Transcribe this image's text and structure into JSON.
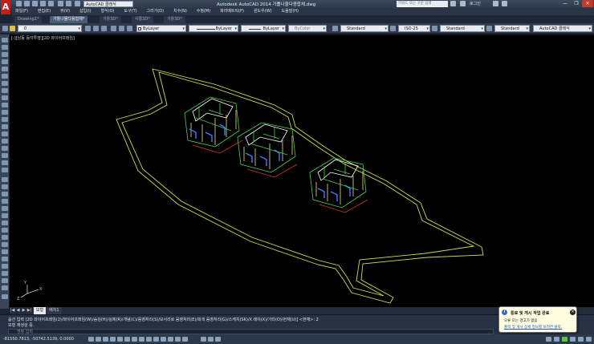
{
  "app": {
    "logo_letter": "A",
    "workspace": "AutoCAD 클래식",
    "title": "Autodesk AutoCAD 2014    가톨나물다용합체.dwg",
    "search_placeholder": "키워드 또는 구문 입력",
    "login": "로그인",
    "window_buttons": [
      "—",
      "❐",
      "✕"
    ]
  },
  "menu": [
    "파일(F)",
    "편집(E)",
    "뷰(V)",
    "삽입(I)",
    "형식(O)",
    "도구(T)",
    "그리기(D)",
    "치수(N)",
    "수정(M)",
    "파라메트릭(P)",
    "윈도우(W)",
    "도움말(H)"
  ],
  "doc_tabs": [
    {
      "label": "Drawing1*",
      "active": false
    },
    {
      "label": "가톨나물다용합체*",
      "active": true
    },
    {
      "label": "가톨3D*",
      "active": false
    },
    {
      "label": "사롱3D*",
      "active": false
    },
    {
      "label": "가톨3D*",
      "active": false
    }
  ],
  "properties": {
    "layer_current": "0",
    "color": "ByLayer",
    "linetype": "ByLayer",
    "lineweight": "ByLayer",
    "plotstyle": "ByColor",
    "text_style": "Standard",
    "dim_style": "ISO-25",
    "table_style": "Standard",
    "mleader_style": "Standard",
    "workspace_right": "AutoCAD 클래식"
  },
  "viewport": {
    "label": "[-][남동 등각투영][2D 와이어프레임]",
    "background": "#000000",
    "ucs_x_label": "X",
    "ucs_y_label": "Y",
    "ucs_z_label": "Z"
  },
  "layout_tabs": {
    "arrows": [
      "|◀",
      "◀",
      "▶",
      "▶|"
    ],
    "tabs": [
      {
        "label": "모형",
        "active": true
      },
      {
        "label": "배치1",
        "active": false
      }
    ]
  },
  "command": {
    "line1": "옵션 입력 [2D 와이어프레임(2)/와이어프레임(W)/숨김(H)/실제(R)/개념(C)/음영처리(S)/모서리로 음영처리(E)/회색 음영처리(G)/스케치(SK)/X 레이(X)/기타(O)/현재(U)] <현재>: 2",
    "line2": "모형 재생성 중.",
    "prompt": "명령 입력"
  },
  "status": {
    "coords": "-81550.7813, -50742.5139, 0.0000"
  },
  "balloon": {
    "title": "통로 및 게시 작업 완료",
    "line1": "오류 또는 경고가 없음",
    "link": "출력 및 게시 상세 정보를 보려면 클릭."
  },
  "colors": {
    "site_outline": "#c9e24a",
    "building_green": "#4ad24a",
    "building_white": "#ffffff",
    "building_blue": "#3f7cff",
    "building_red": "#d23a2a",
    "building_yellow": "#f0e070"
  }
}
